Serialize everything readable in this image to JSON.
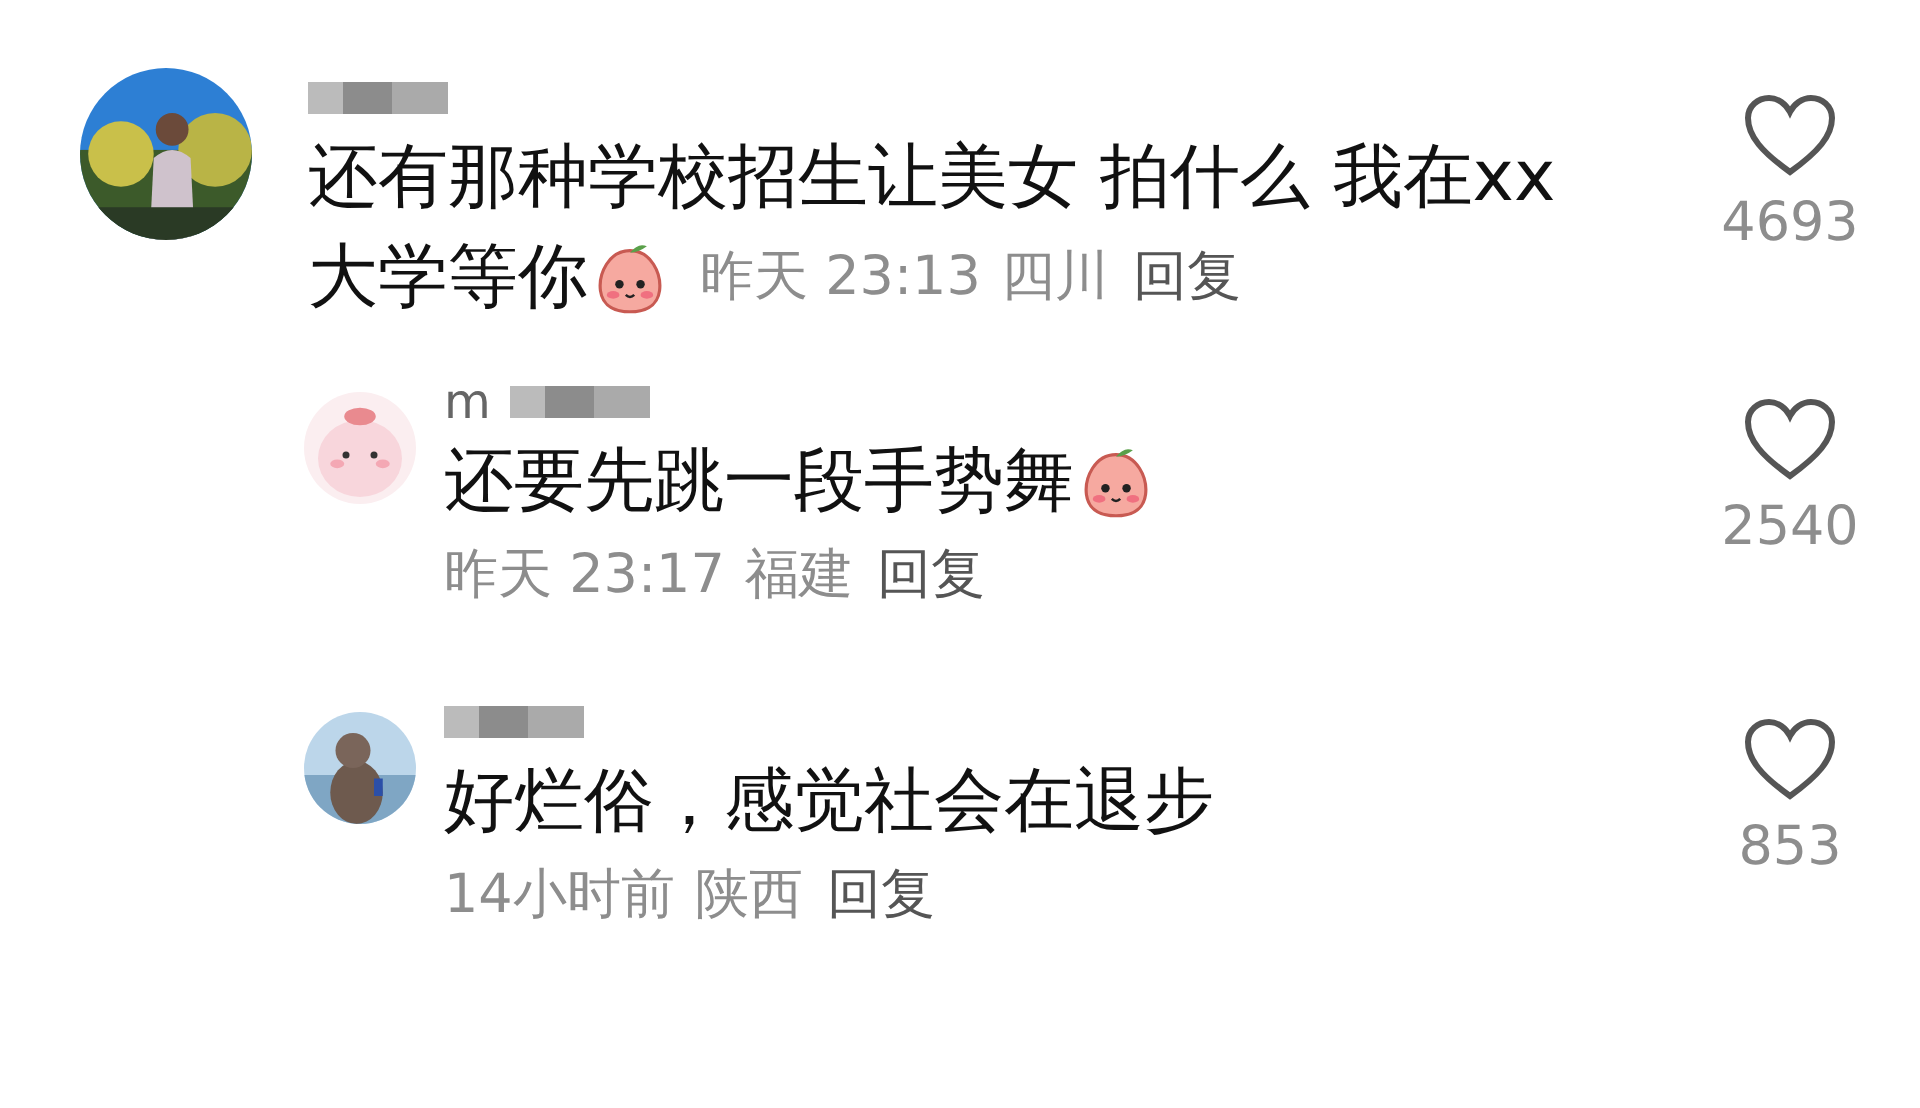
{
  "comments": [
    {
      "text_lines": [
        "还有那种学校招生让美女 拍什么 我在xx",
        "大学等你"
      ],
      "emoji": true,
      "time": "昨天 23:13",
      "location": "四川",
      "reply": "回复",
      "likes": "4693",
      "liked": false,
      "children": [
        {
          "username": "m",
          "text_lines": [
            "还要先跳一段手势舞"
          ],
          "emoji": true,
          "time": "昨天 23:17",
          "location": "福建",
          "reply": "回复",
          "likes": "2540",
          "liked": false
        },
        {
          "text_lines": [
            "好烂俗，感觉社会在退步"
          ],
          "emoji": false,
          "time": "14小时前",
          "location": "陕西",
          "reply": "回复",
          "likes": "853",
          "liked": false
        }
      ]
    }
  ]
}
